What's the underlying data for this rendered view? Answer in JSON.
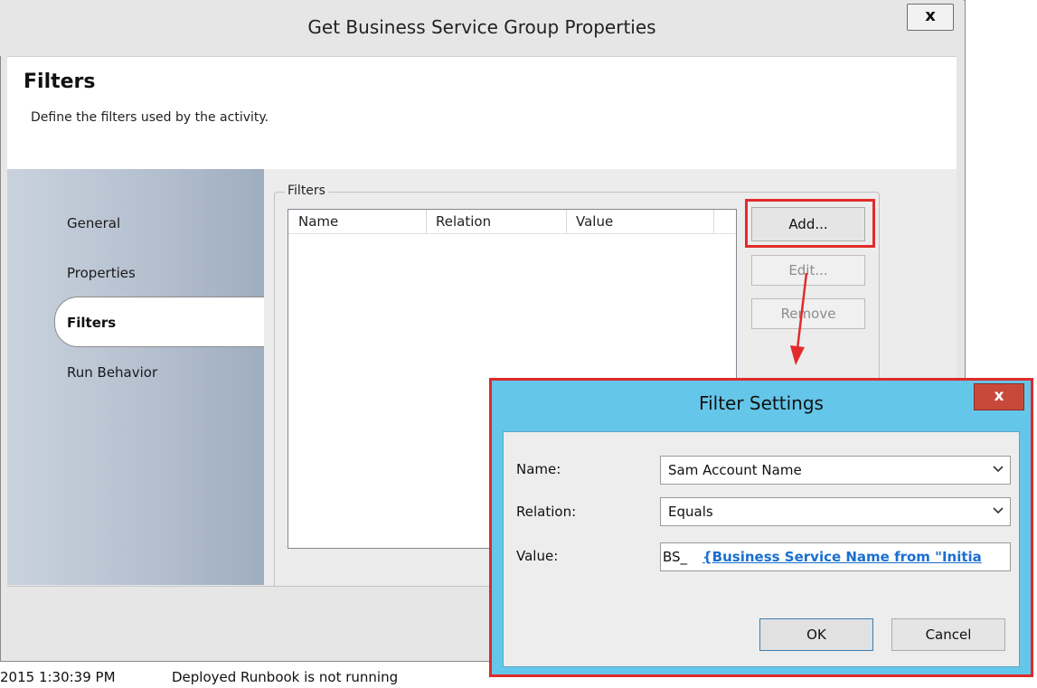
{
  "window": {
    "title": "Get Business Service Group Properties",
    "close_label": "x"
  },
  "header": {
    "title": "Filters",
    "description": "Define the filters used by the activity."
  },
  "nav": {
    "items": [
      {
        "label": "General",
        "selected": false
      },
      {
        "label": "Properties",
        "selected": false
      },
      {
        "label": "Filters",
        "selected": true
      },
      {
        "label": "Run Behavior",
        "selected": false
      }
    ]
  },
  "filters_group": {
    "label": "Filters",
    "columns": [
      "Name",
      "Relation",
      "Value"
    ],
    "rows": [],
    "buttons": {
      "add": "Add...",
      "edit": "Edit...",
      "remove": "Remove"
    }
  },
  "status": {
    "time": "2015 1:30:39 PM",
    "message": "Deployed Runbook is not running"
  },
  "filter_settings": {
    "title": "Filter Settings",
    "close_label": "x",
    "name_label": "Name:",
    "name_value": "Sam Account Name",
    "relation_label": "Relation:",
    "relation_value": "Equals",
    "value_label": "Value:",
    "value_prefix": "BS_",
    "value_token": "{Business Service Name from \"Initia",
    "ok": "OK",
    "cancel": "Cancel"
  },
  "colors": {
    "highlight": "#e22b2b",
    "dialog_title_bar": "#64c6e9",
    "close_button": "#c8493a",
    "link_token": "#1a6fd0"
  }
}
